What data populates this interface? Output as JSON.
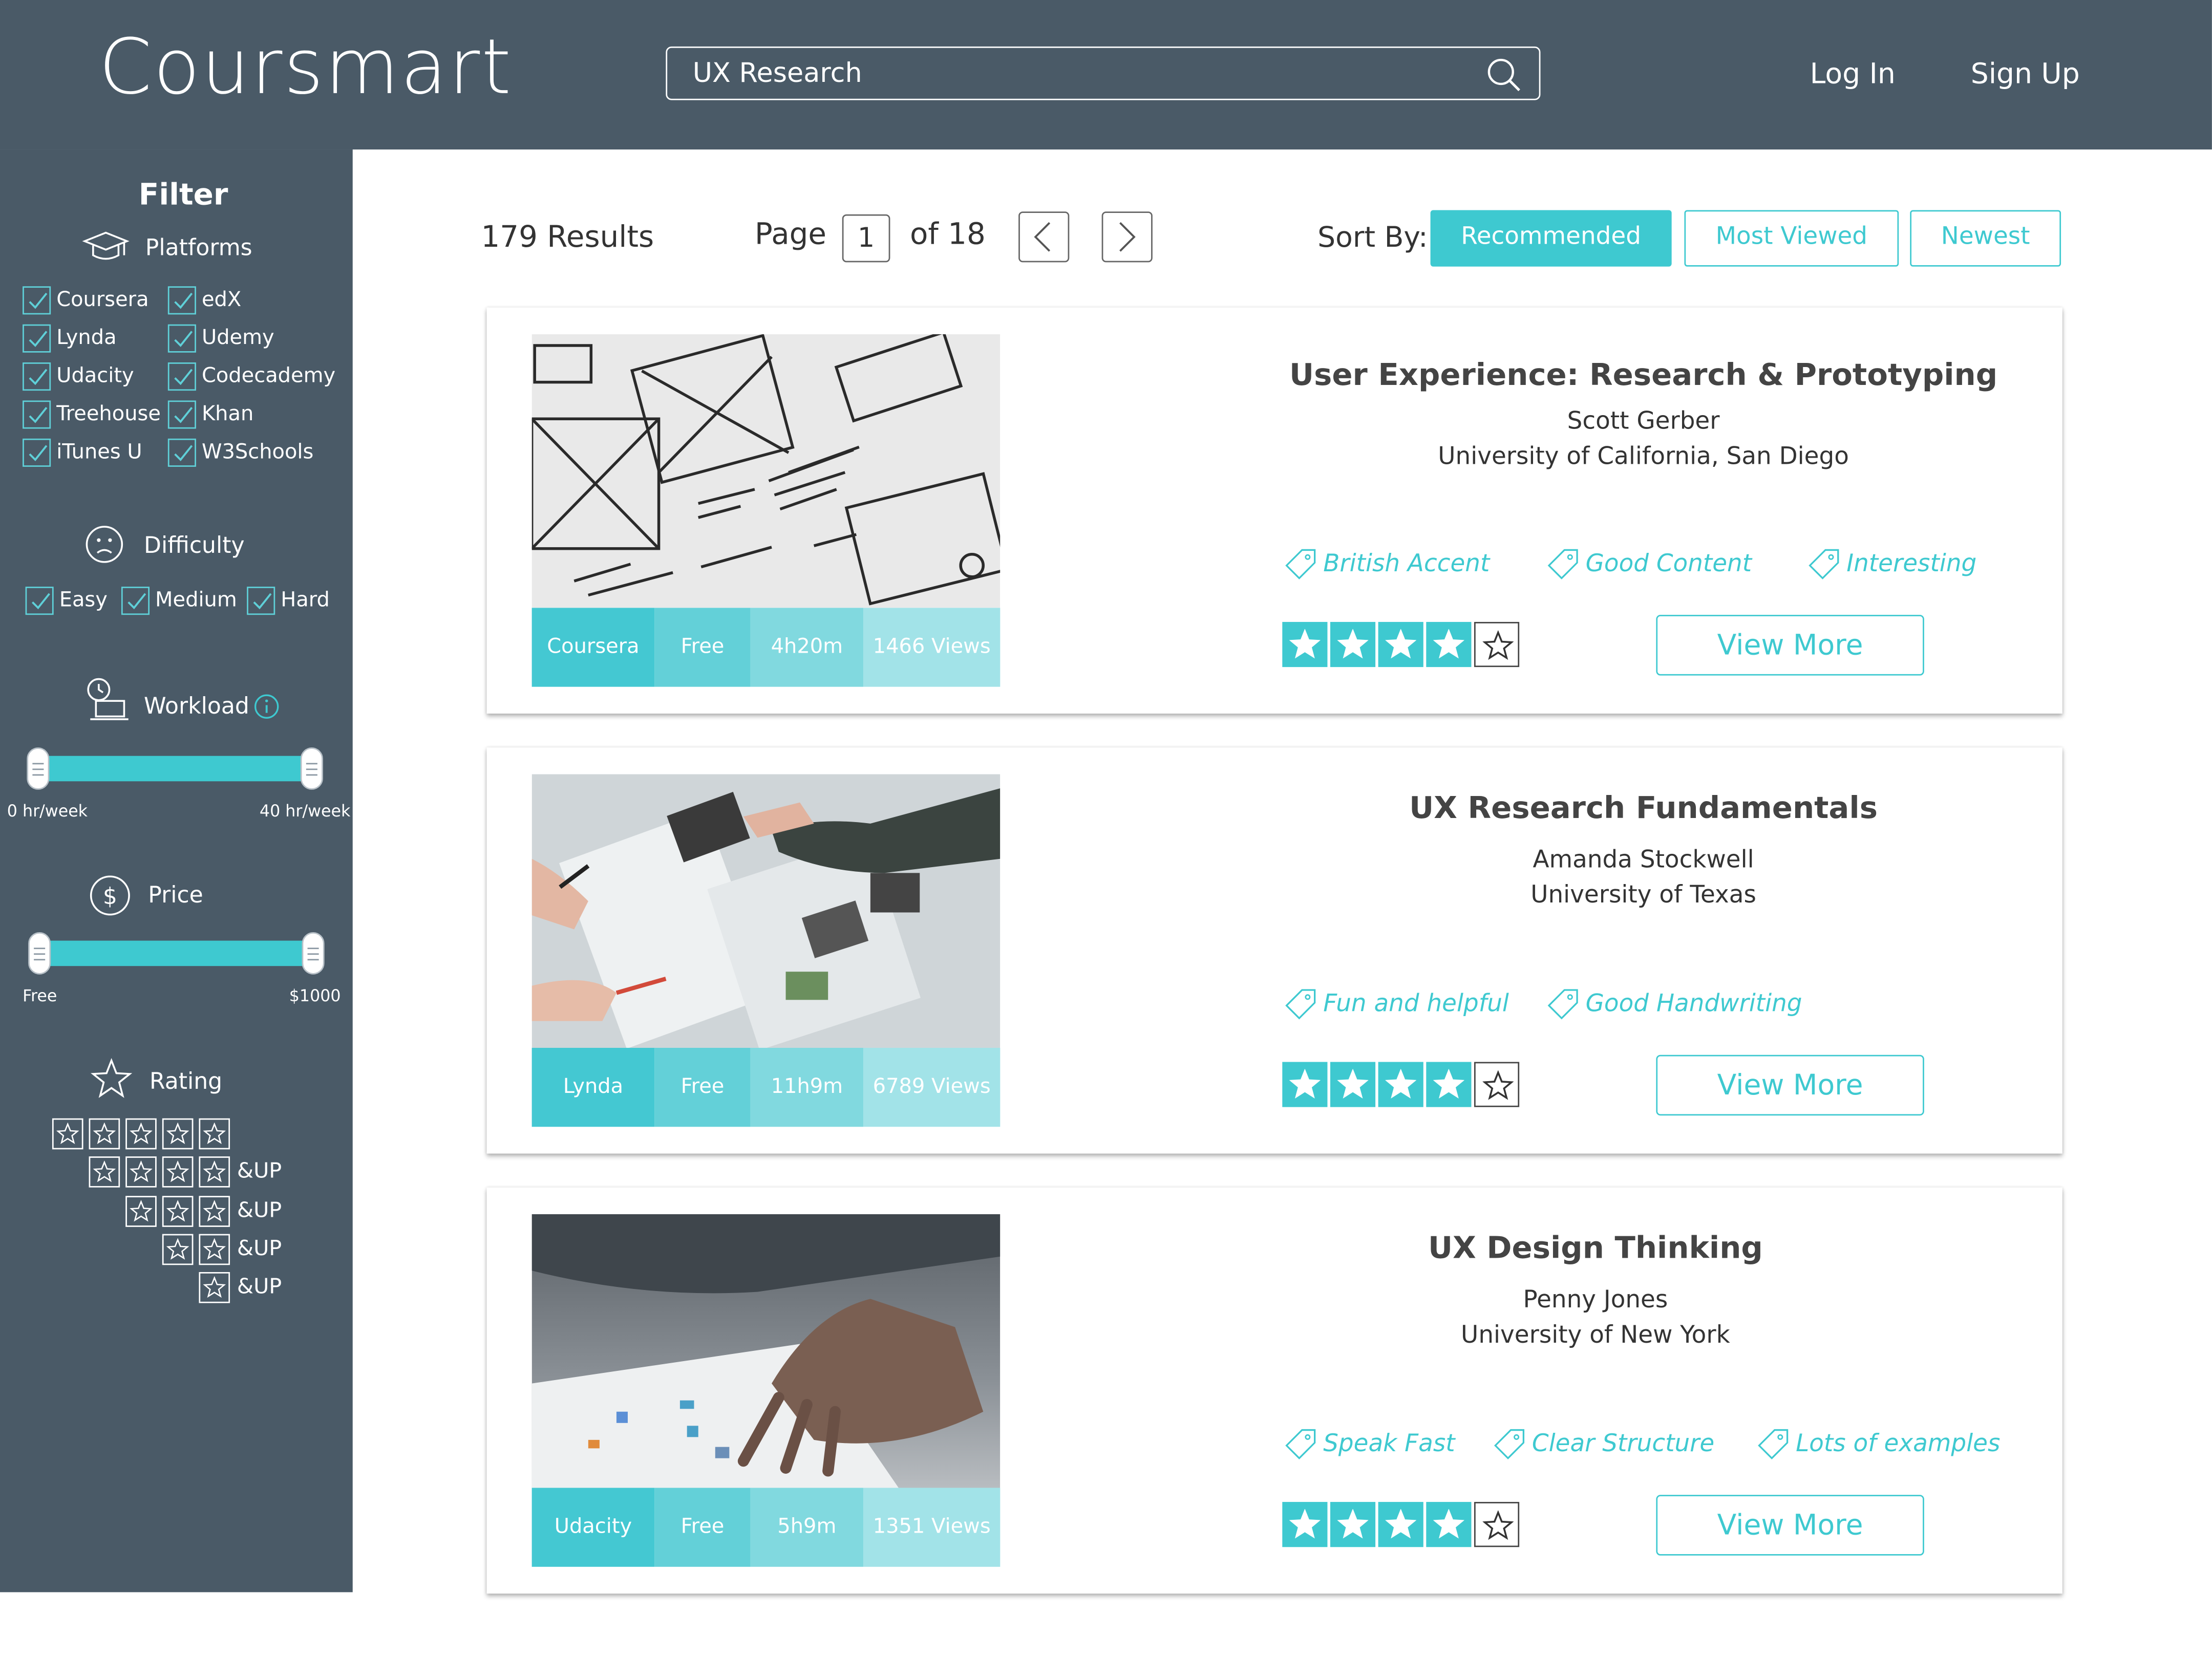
{
  "app": {
    "logo": "Coursmart"
  },
  "header": {
    "search": {
      "value": "UX Research",
      "icon": "search-icon"
    },
    "login_label": "Log In",
    "signup_label": "Sign Up"
  },
  "sidebar": {
    "filter_title": "Filter",
    "platforms": {
      "heading": "Platforms",
      "icon": "graduation-cap-icon",
      "items": [
        "Coursera",
        "edX",
        "Lynda",
        "Udemy",
        "Udacity",
        "Codecademy",
        "Treehouse",
        "Khan",
        "iTunes U",
        "W3Schools"
      ]
    },
    "difficulty": {
      "heading": "Difficulty",
      "icon": "face-icon",
      "items": [
        "Easy",
        "Medium",
        "Hard"
      ]
    },
    "workload": {
      "heading": "Workload",
      "icon": "clock-laptop-icon",
      "info_icon": "info-icon",
      "min_label": "0 hr/week",
      "max_label": "40 hr/week"
    },
    "price": {
      "heading": "Price",
      "icon": "dollar-icon",
      "min_label": "Free",
      "max_label": "$1000"
    },
    "rating": {
      "heading": "Rating",
      "icon": "star-outline-icon",
      "up_label": "&UP",
      "options": [
        5,
        4,
        3,
        2,
        1
      ]
    }
  },
  "results": {
    "count_label": "179 Results",
    "page_label": "Page",
    "page_value": "1",
    "of_label": "of 18",
    "sort_label": "Sort By:",
    "sort_options": [
      "Recommended",
      "Most Viewed",
      "Newest"
    ],
    "sort_active": "Recommended"
  },
  "courses": [
    {
      "title": "User Experience: Research & Prototyping",
      "instructor": "Scott Gerber",
      "school": "University of California, San Diego",
      "platform": "Coursera",
      "price": "Free",
      "duration": "4h20m",
      "views": "1466 Views",
      "tags": [
        "British Accent",
        "Good Content",
        "Interesting"
      ],
      "rating": 4,
      "cta": "View More"
    },
    {
      "title": "UX Research Fundamentals",
      "instructor": "Amanda Stockwell",
      "school": "University of Texas",
      "platform": "Lynda",
      "price": "Free",
      "duration": "11h9m",
      "views": "6789 Views",
      "tags": [
        "Fun and helpful",
        "Good Handwriting"
      ],
      "rating": 4,
      "cta": "View More"
    },
    {
      "title": "UX Design Thinking",
      "instructor": "Penny Jones",
      "school": "University of New York",
      "platform": "Udacity",
      "price": "Free",
      "duration": "5h9m",
      "views": "1351 Views",
      "tags": [
        "Speak Fast",
        "Clear Structure",
        "Lots of examples"
      ],
      "rating": 4,
      "cta": "View More"
    }
  ],
  "colors": {
    "header_bg": "#4a5a67",
    "accent": "#3ec9d0"
  }
}
